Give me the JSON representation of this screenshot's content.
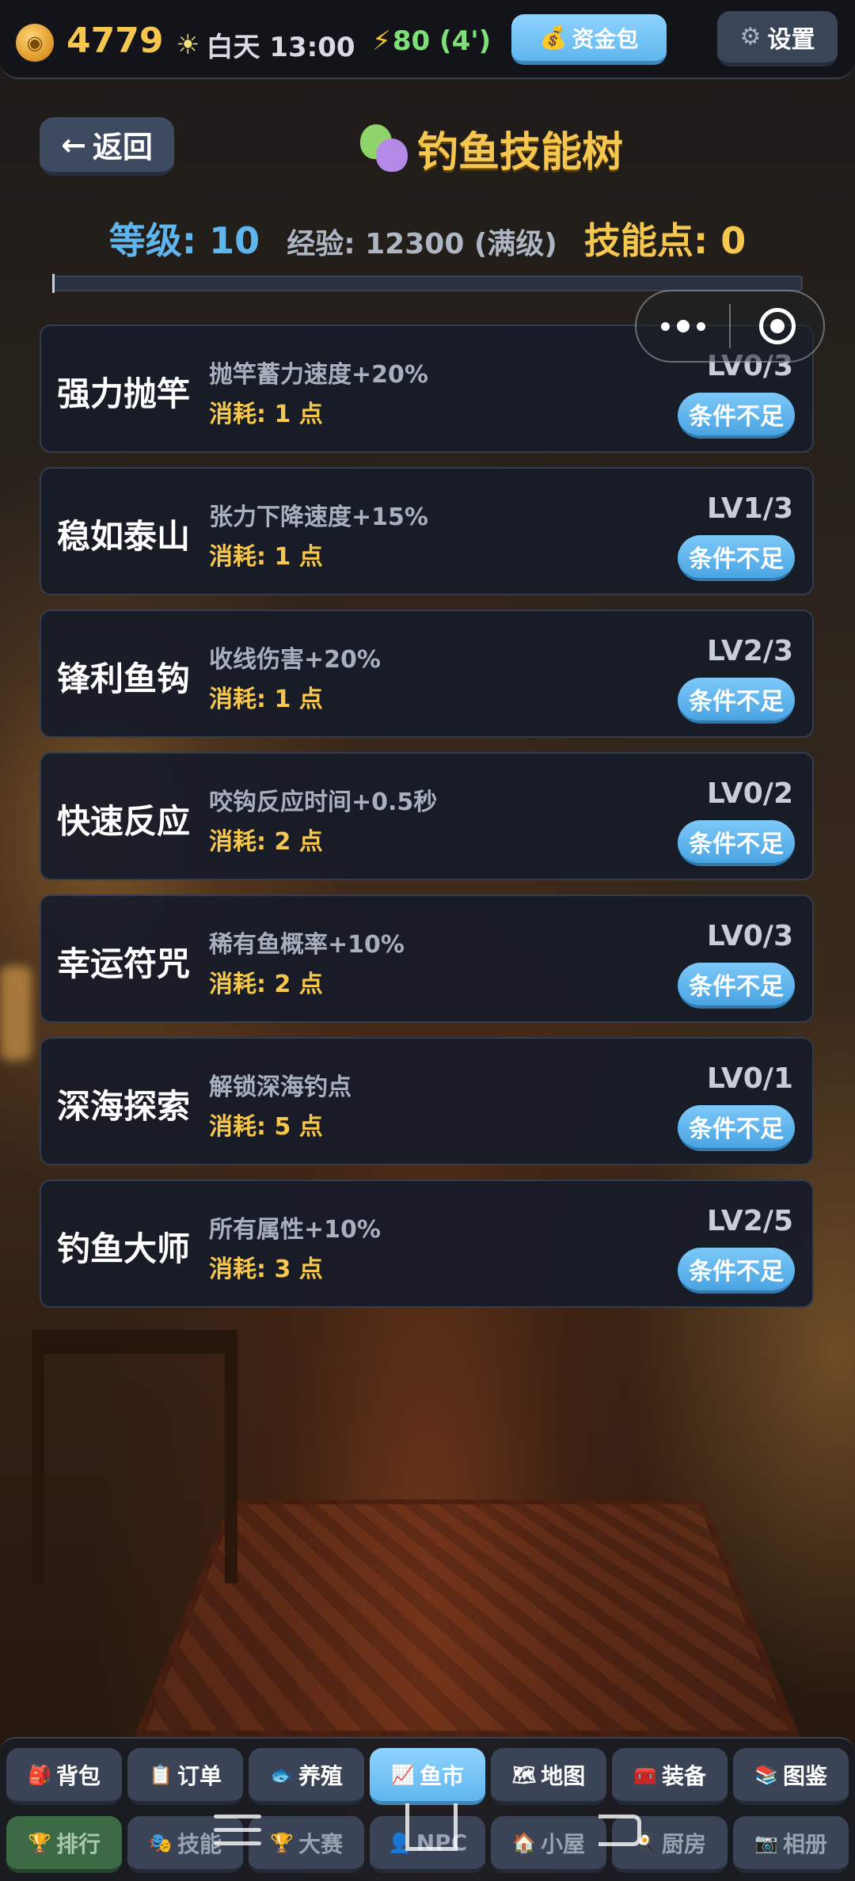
{
  "topbar": {
    "coins": "4779",
    "time": "白天 13:00",
    "energy": "80 (4')",
    "fund_label": "资金包",
    "settings_label": "设置"
  },
  "header": {
    "back_label": "返回",
    "title": "钓鱼技能树"
  },
  "stats": {
    "level": "等级: 10",
    "exp": "经验: 12300 (满级)",
    "points": "技能点: 0",
    "progress": 0
  },
  "skills": [
    {
      "name": "强力抛竿",
      "desc": "抛竿蓄力速度+20%",
      "cost": "消耗: 1 点",
      "level": "LV0/3",
      "button": "条件不足"
    },
    {
      "name": "稳如泰山",
      "desc": "张力下降速度+15%",
      "cost": "消耗: 1 点",
      "level": "LV1/3",
      "button": "条件不足"
    },
    {
      "name": "锋利鱼钩",
      "desc": "收线伤害+20%",
      "cost": "消耗: 1 点",
      "level": "LV2/3",
      "button": "条件不足"
    },
    {
      "name": "快速反应",
      "desc": "咬钩反应时间+0.5秒",
      "cost": "消耗: 2 点",
      "level": "LV0/2",
      "button": "条件不足"
    },
    {
      "name": "幸运符咒",
      "desc": "稀有鱼概率+10%",
      "cost": "消耗: 2 点",
      "level": "LV0/3",
      "button": "条件不足"
    },
    {
      "name": "深海探索",
      "desc": "解锁深海钓点",
      "cost": "消耗: 5 点",
      "level": "LV0/1",
      "button": "条件不足"
    },
    {
      "name": "钓鱼大师",
      "desc": "所有属性+10%",
      "cost": "消耗: 3 点",
      "level": "LV2/5",
      "button": "条件不足"
    }
  ],
  "nav": {
    "row1": [
      {
        "label": "背包",
        "icon": "backpack-icon"
      },
      {
        "label": "订单",
        "icon": "order-icon"
      },
      {
        "label": "养殖",
        "icon": "breeding-icon"
      },
      {
        "label": "鱼市",
        "icon": "chart-icon"
      },
      {
        "label": "地图",
        "icon": "map-icon"
      },
      {
        "label": "装备",
        "icon": "equipment-icon"
      },
      {
        "label": "图鉴",
        "icon": "book-icon"
      }
    ],
    "row2": [
      {
        "label": "排行",
        "icon": "trophy-icon"
      },
      {
        "label": "技能",
        "icon": "masks-icon"
      },
      {
        "label": "大赛",
        "icon": "trophy-icon"
      },
      {
        "label": "NPC",
        "icon": "person-icon"
      },
      {
        "label": "小屋",
        "icon": "house-icon"
      },
      {
        "label": "厨房",
        "icon": "kitchen-icon"
      },
      {
        "label": "相册",
        "icon": "camera-icon"
      }
    ]
  },
  "colors": {
    "gold": "#f6c74f",
    "accent_blue": "#5fb6ee",
    "card_bg": "#161c28"
  }
}
